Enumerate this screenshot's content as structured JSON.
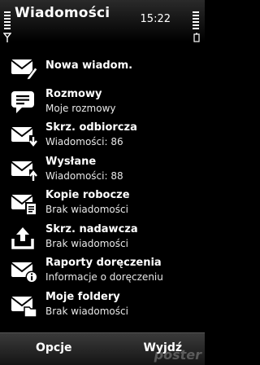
{
  "header": {
    "title": "Wiadomości",
    "time": "15:22"
  },
  "items": [
    {
      "icon": "new-message-icon",
      "line1": "Nowa wiadom.",
      "line2": ""
    },
    {
      "icon": "conversations-icon",
      "line1": "Rozmowy",
      "line2": "Moje rozmowy"
    },
    {
      "icon": "inbox-icon",
      "line1": "Skrz. odbiorcza",
      "line2": "Wiadomości: 86"
    },
    {
      "icon": "sent-icon",
      "line1": "Wysłane",
      "line2": "Wiadomości: 88"
    },
    {
      "icon": "drafts-icon",
      "line1": "Kopie robocze",
      "line2": "Brak wiadomości"
    },
    {
      "icon": "outbox-icon",
      "line1": "Skrz. nadawcza",
      "line2": "Brak wiadomości"
    },
    {
      "icon": "delivery-reports-icon",
      "line1": "Raporty doręczenia",
      "line2": "Informacje o doręczeniu"
    },
    {
      "icon": "my-folders-icon",
      "line1": "Moje foldery",
      "line2": "Brak wiadomości"
    }
  ],
  "softkeys": {
    "left": "Opcje",
    "right": "Wyjdź"
  },
  "watermark": "poster"
}
